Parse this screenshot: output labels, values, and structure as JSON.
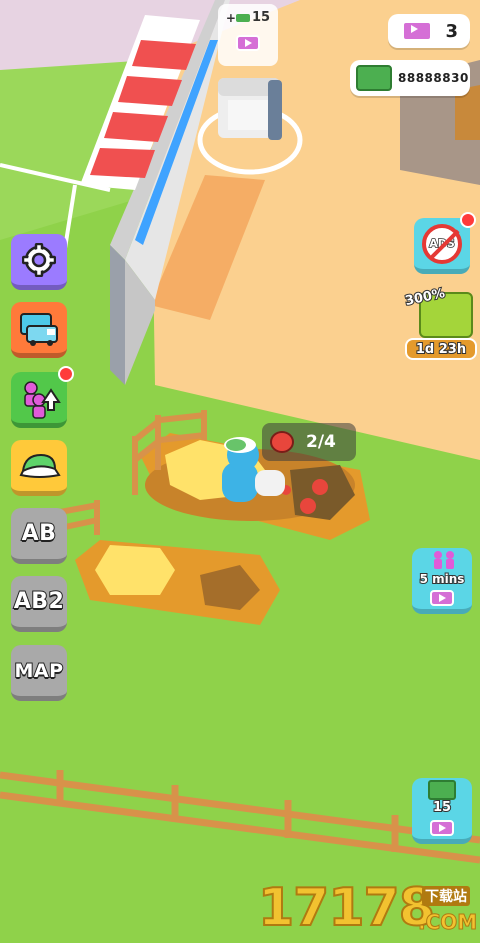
{
  "hud": {
    "tickets": {
      "value": "3",
      "icon": "ticket-icon"
    },
    "money": {
      "value": "88888830",
      "icon": "cash-stack-icon"
    },
    "pickup": {
      "label": "+ ",
      "value": "15",
      "icon": "cash-icon"
    }
  },
  "left_menu": {
    "settings_icon": "gear-icon",
    "vehicle_icon": "van-icon",
    "upgrade_icon": "worker-upgrade-icon",
    "cap_icon": "cap-icon",
    "ab_label": "AB",
    "ab2_label": "AB2",
    "map_label": "MAP"
  },
  "right_menu": {
    "no_ads_label": "ADS",
    "boost_percent": "300%",
    "boost_timer": "1d 23h",
    "workers_label": "5 mins",
    "cash_reward": "15"
  },
  "farm": {
    "harvest_counter": "2/4",
    "crop_icon": "tomato-icon"
  },
  "watermark": {
    "number": "17178",
    "sub": "下载站",
    "domain": ".COM"
  },
  "colors": {
    "grass": "#8fd24a",
    "floor": "#fbd08f",
    "soil": "#e49a2c",
    "accent_blue": "#5bd6e6",
    "left_button": "#9b7bff"
  }
}
